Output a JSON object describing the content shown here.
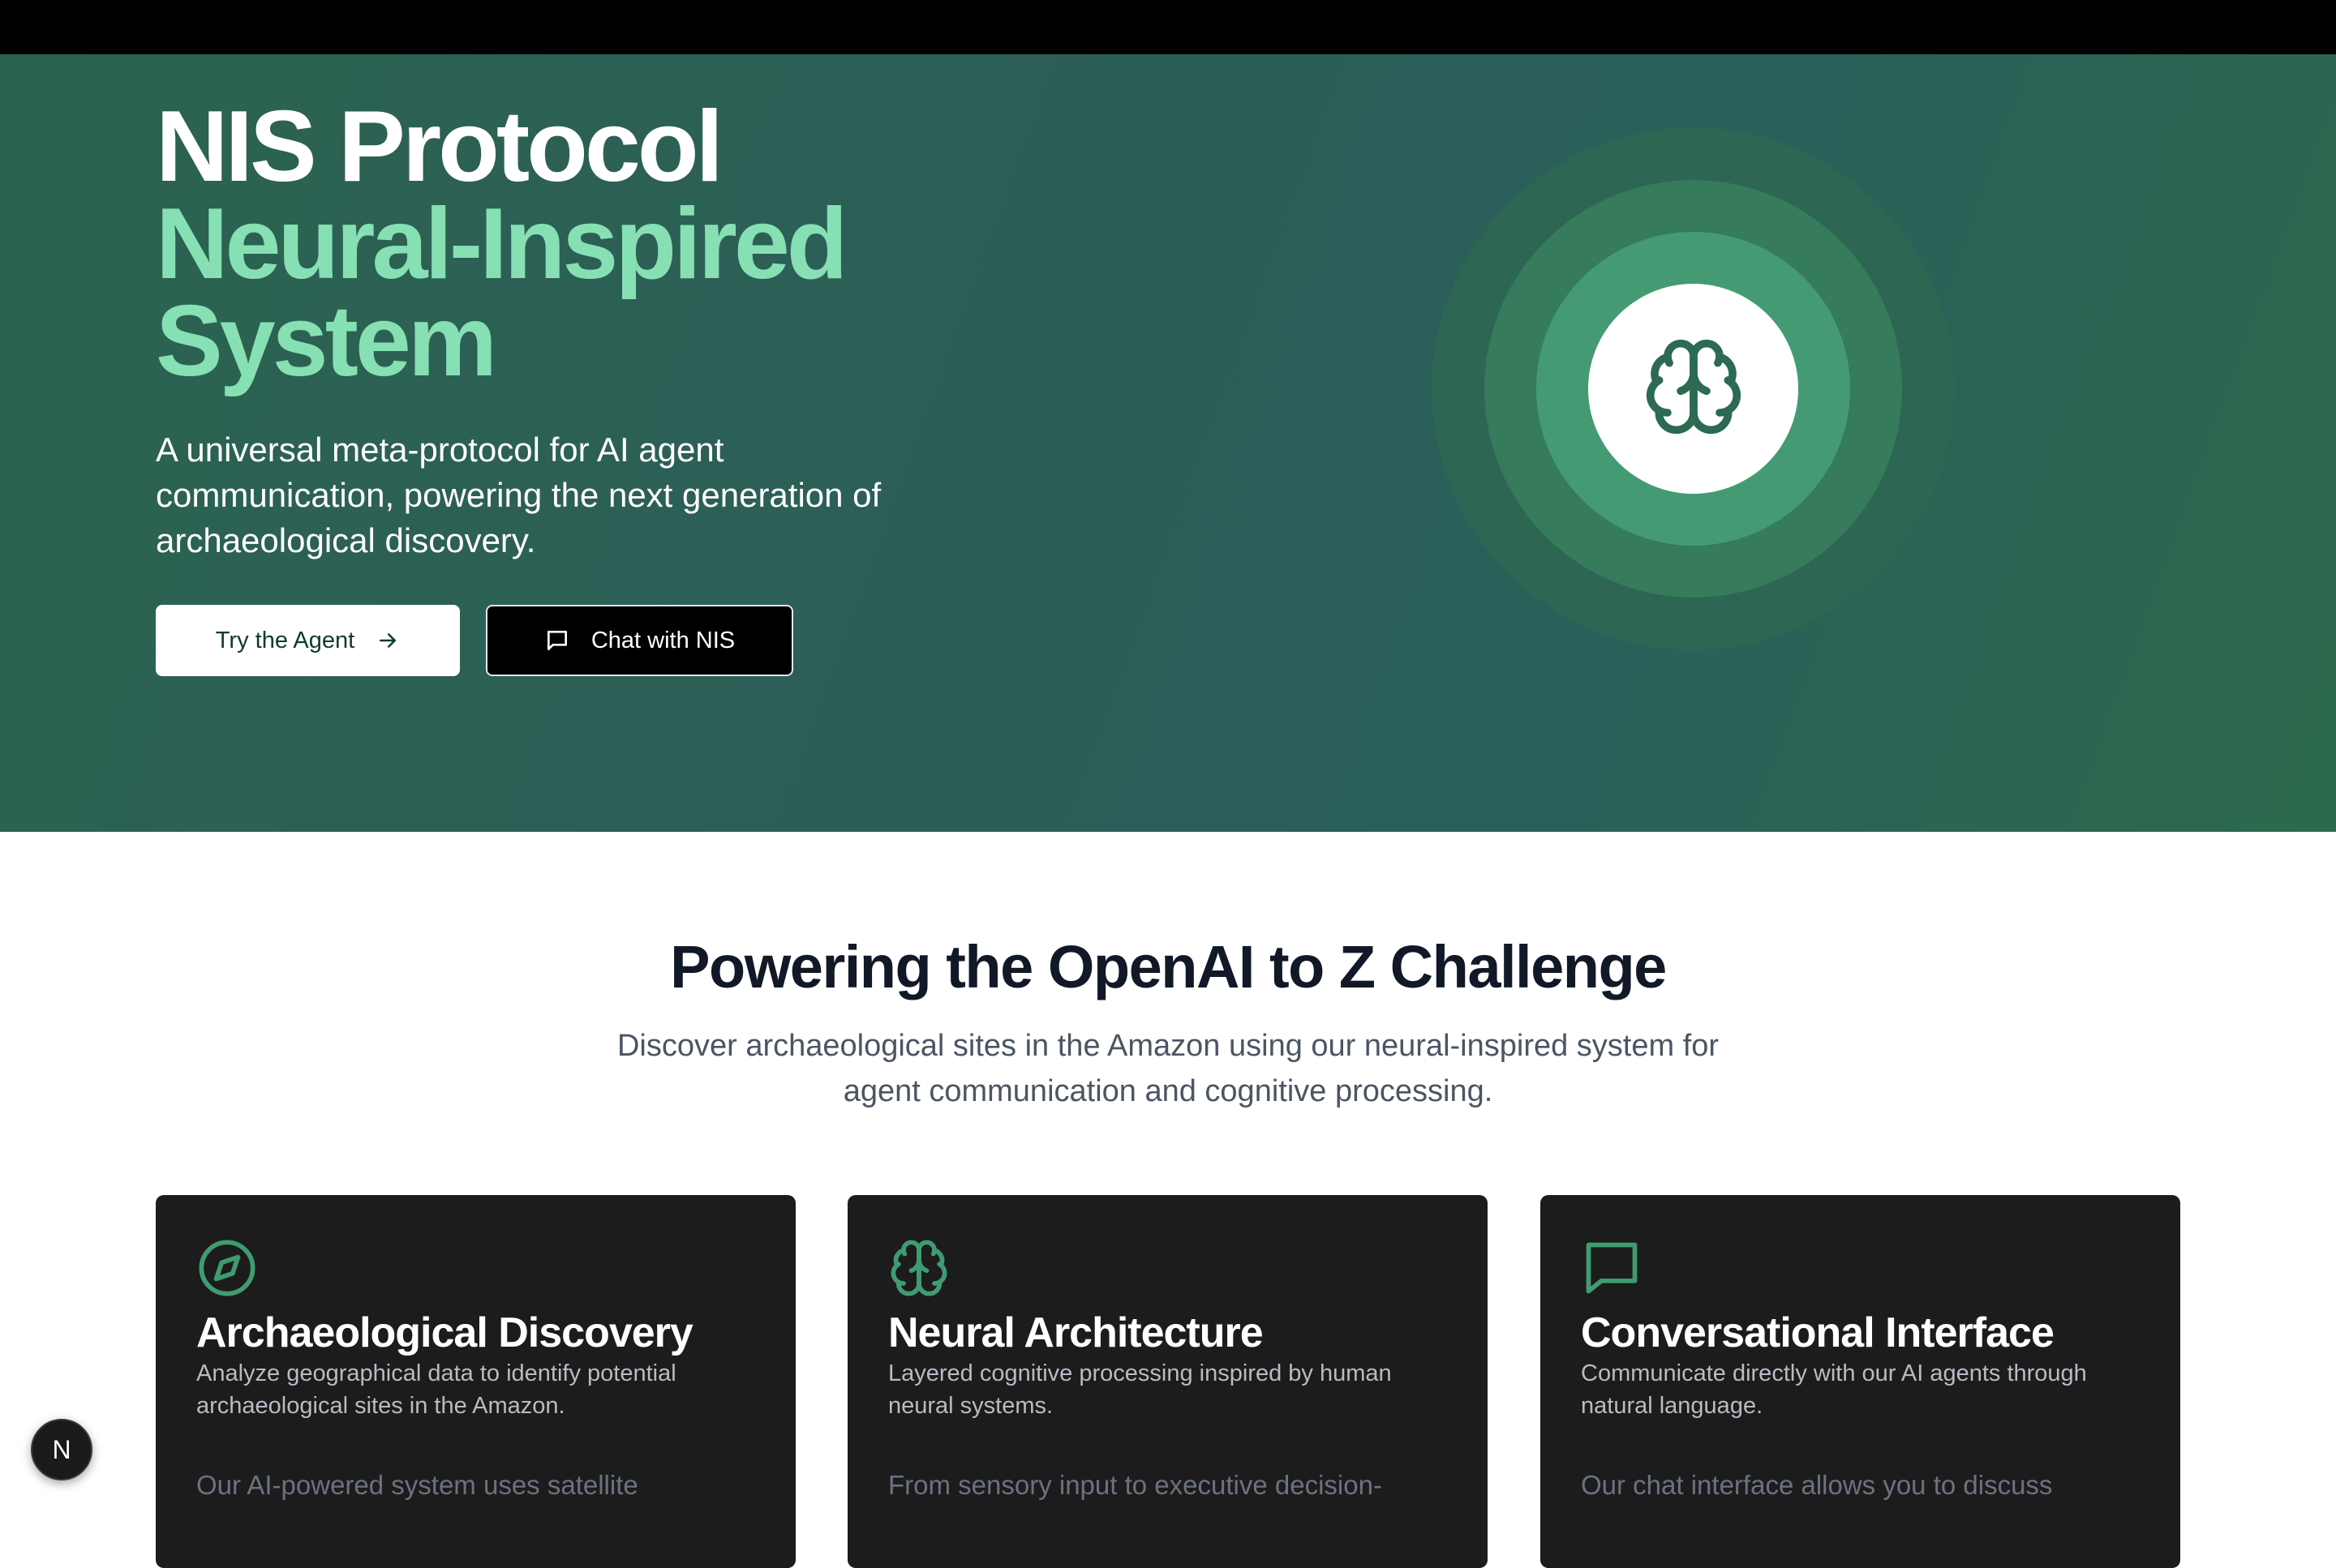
{
  "hero": {
    "title_line1": "NIS Protocol",
    "title_line2": "Neural-Inspired",
    "title_line3": "System",
    "subtitle": "A universal meta-protocol for AI agent communication, powering the next generation of archaeological discovery.",
    "primary_button_label": "Try the Agent",
    "primary_button_icon": "arrow-right-icon",
    "secondary_button_label": "Chat with NIS",
    "secondary_button_icon": "chat-bubble-icon",
    "emblem_icon": "brain-icon"
  },
  "section": {
    "title": "Powering the OpenAI to Z Challenge",
    "subtitle": "Discover archaeological sites in the Amazon using our neural-inspired system for agent communication and cognitive processing."
  },
  "cards": [
    {
      "icon": "compass-icon",
      "title": "Archaeological Discovery",
      "description": "Analyze geographical data to identify potential archaeological sites in the Amazon.",
      "body": "Our AI-powered system uses satellite"
    },
    {
      "icon": "brain-icon",
      "title": "Neural Architecture",
      "description": "Layered cognitive processing inspired by human neural systems.",
      "body": "From sensory input to executive decision-"
    },
    {
      "icon": "chat-bubble-icon",
      "title": "Conversational Interface",
      "description": "Communicate directly with our AI agents through natural language.",
      "body": "Our chat interface allows you to discuss"
    }
  ],
  "dev_badge": {
    "label": "N",
    "icon": "nextjs-logo-icon"
  },
  "colors": {
    "hero_bg": "#2c5e58",
    "accent_green": "#86e0b3",
    "icon_green": "#3f9c72",
    "card_bg": "#1c1c1c",
    "heading_dark": "#111827"
  }
}
